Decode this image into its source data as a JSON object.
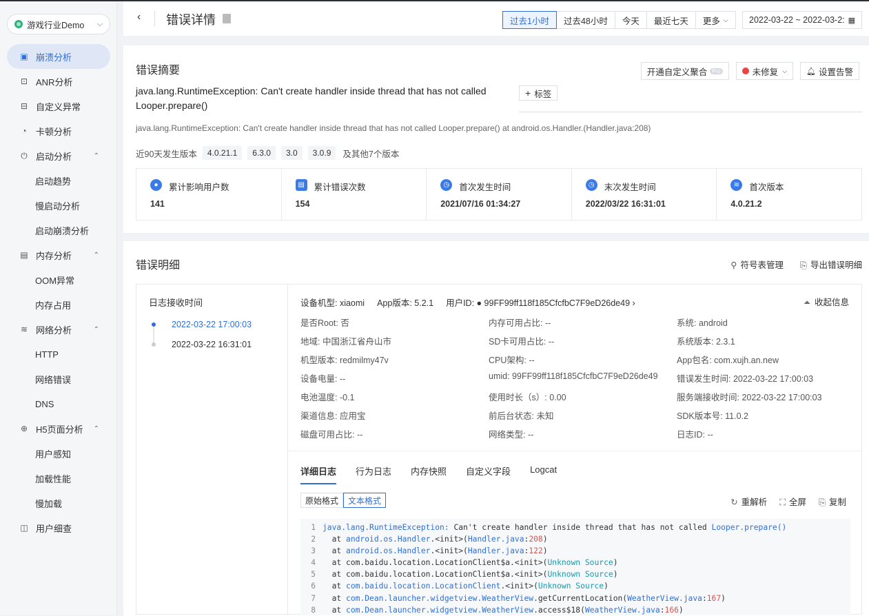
{
  "app": {
    "name": "游戏行业Demo"
  },
  "nav": [
    {
      "label": "崩溃分析",
      "icon": "crash-icon",
      "active": true
    },
    {
      "label": "ANR分析",
      "icon": "anr-icon"
    },
    {
      "label": "自定义异常",
      "icon": "custom-exception-icon"
    },
    {
      "label": "卡顿分析",
      "icon": "lag-icon"
    },
    {
      "label": "启动分析",
      "icon": "startup-icon",
      "expandable": true
    },
    {
      "label": "启动趋势",
      "sub": true
    },
    {
      "label": "慢启动分析",
      "sub": true
    },
    {
      "label": "启动崩溃分析",
      "sub": true
    },
    {
      "label": "内存分析",
      "icon": "memory-icon",
      "expandable": true
    },
    {
      "label": "OOM异常",
      "sub": true
    },
    {
      "label": "内存占用",
      "sub": true
    },
    {
      "label": "网络分析",
      "icon": "wifi-icon",
      "expandable": true
    },
    {
      "label": "HTTP",
      "sub": true
    },
    {
      "label": "网络错误",
      "sub": true
    },
    {
      "label": "DNS",
      "sub": true
    },
    {
      "label": "H5页面分析",
      "icon": "h5-icon",
      "expandable": true
    },
    {
      "label": "用户感知",
      "sub": true
    },
    {
      "label": "加载性能",
      "sub": true
    },
    {
      "label": "慢加载",
      "sub": true
    },
    {
      "label": "用户细查",
      "icon": "user-detail-icon"
    }
  ],
  "header": {
    "title": "错误详情",
    "ranges": [
      "过去1小时",
      "过去48小时",
      "今天",
      "最近七天",
      "更多"
    ],
    "date_range": "2022-03-22 ~ 2022-03-2:"
  },
  "summary": {
    "title": "错误摘要",
    "btn_aggregate": "开通自定义聚合",
    "pro": "Pro",
    "btn_status": "未修复",
    "btn_alert": "设置告警",
    "exception": "java.lang.RuntimeException: Can't create handler inside thread that has not called Looper.prepare()",
    "tag_btn": "标签",
    "exception_sub": "java.lang.RuntimeException: Can't create handler inside thread that has not called Looper.prepare()    at android.os.Handler.(Handler.java:208)",
    "versions_label": "近90天发生版本",
    "versions": [
      "4.0.21.1",
      "6.3.0",
      "3.0",
      "3.0.9"
    ],
    "versions_more": "及其他7个版本",
    "stats": [
      {
        "label": "累计影响用户数",
        "value": "141",
        "icon": "users-icon"
      },
      {
        "label": "累计错误次数",
        "value": "154",
        "icon": "error-count-icon"
      },
      {
        "label": "首次发生时间",
        "value": "2021/07/16 01:34:27",
        "icon": "clock-icon"
      },
      {
        "label": "末次发生时间",
        "value": "2022/03/22 16:31:01",
        "icon": "clock-icon"
      },
      {
        "label": "首次版本",
        "value": "4.0.21.2",
        "icon": "layers-icon"
      }
    ]
  },
  "detail": {
    "title": "错误明细",
    "symbol_mgmt": "符号表管理",
    "export": "导出错误明细",
    "log_head": "日志接收时间",
    "log_times": [
      "2022-03-22 17:00:03",
      "2022-03-22 16:31:01"
    ],
    "device": "设备机型: xiaomi",
    "app_version": "App版本: 5.2.1",
    "user_id": "用户ID: ● 99FF99ff118f185CfcfbC7F9eD26de49 ›",
    "collapse": "收起信息",
    "info": [
      [
        "是否Root: 否",
        "内存可用占比: --",
        "系统: android"
      ],
      [
        "地域: 中国浙江省舟山市",
        "SD卡可用占比: --",
        "系统版本: 2.3.1"
      ],
      [
        "机型版本: redmilmy47v",
        "CPU架构: --",
        "App包名: com.xujh.an.new"
      ],
      [
        "设备电量: --",
        "umid: 99FF99ff118f185CfcfbC7F9eD26de49",
        "错误发生时间: 2022-03-22 17:00:03"
      ],
      [
        "电池温度: -0.1",
        "使用时长（s）: 0.00",
        "服务端接收时间: 2022-03-22 17:00:03"
      ],
      [
        "渠道信息: 应用宝",
        "前后台状态: 未知",
        "SDK版本号: 11.0.2"
      ],
      [
        "磁盘可用占比: --",
        "网络类型: --",
        "日志ID: --"
      ]
    ],
    "tabs": [
      "详细日志",
      "行为日志",
      "内存快照",
      "自定义字段",
      "Logcat"
    ],
    "fmt": [
      "原始格式",
      "文本格式"
    ],
    "code_actions": [
      "重解析",
      "全屏",
      "复制"
    ],
    "code": [
      "java.lang.RuntimeException: Can't create handler inside thread that has not called Looper.prepare()",
      "  at android.os.Handler.<init>(Handler.java:208)",
      "  at android.os.Handler.<init>(Handler.java:122)",
      "  at com.baidu.location.LocationClient$a.<init>(Unknown Source)",
      "  at com.baidu.location.LocationClient$a.<init>(Unknown Source)",
      "  at com.baidu.location.LocationClient.<init>(Unknown Source)",
      "  at com.Dean.launcher.widgetview.WeatherView.getCurrentLocation(WeatherView.java:167)",
      "  at com.Dean.launcher.widgetview.WeatherView.access$18(WeatherView.java:166)"
    ]
  }
}
